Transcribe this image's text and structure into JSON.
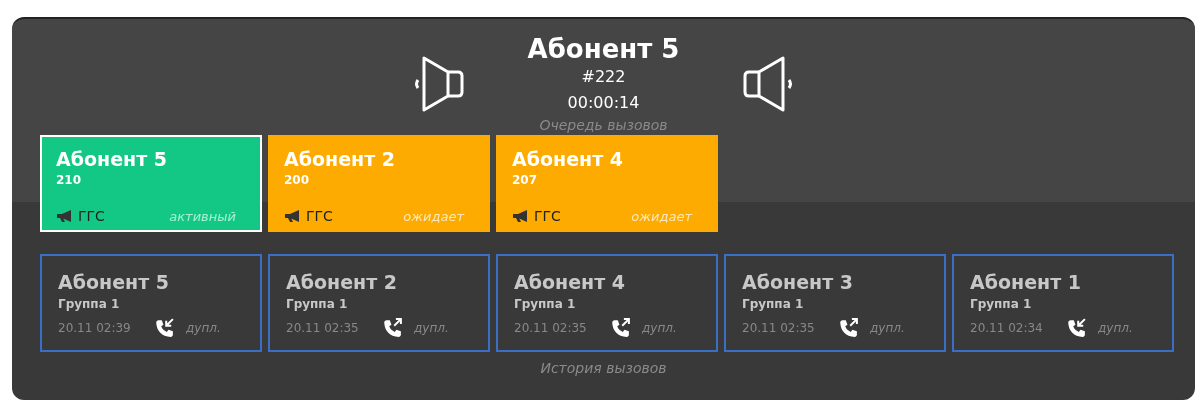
{
  "current_call": {
    "name": "Абонент 5",
    "number": "#222",
    "duration": "00:00:14"
  },
  "queue": {
    "title": "Очередь вызовов",
    "items": [
      {
        "name": "Абонент 5",
        "number": "210",
        "type": "ГГС",
        "status": "активный",
        "selected": true
      },
      {
        "name": "Абонент 2",
        "number": "200",
        "type": "ГГС",
        "status": "ожидает",
        "selected": false
      },
      {
        "name": "Абонент 4",
        "number": "207",
        "type": "ГГС",
        "status": "ожидает",
        "selected": false
      }
    ]
  },
  "history": {
    "title": "История вызовов",
    "items": [
      {
        "name": "Абонент 5",
        "group": "Группа 1",
        "time": "20.11 02:39",
        "kind": "incoming",
        "mode": "дупл."
      },
      {
        "name": "Абонент 2",
        "group": "Группа 1",
        "time": "20.11 02:35",
        "kind": "outgoing",
        "mode": "дупл."
      },
      {
        "name": "Абонент 4",
        "group": "Группа 1",
        "time": "20.11 02:35",
        "kind": "outgoing",
        "mode": "дупл."
      },
      {
        "name": "Абонент 3",
        "group": "Группа 1",
        "time": "20.11 02:35",
        "kind": "outgoing",
        "mode": "дупл."
      },
      {
        "name": "Абонент 1",
        "group": "Группа 1",
        "time": "20.11 02:34",
        "kind": "incoming",
        "mode": "дупл."
      }
    ]
  }
}
